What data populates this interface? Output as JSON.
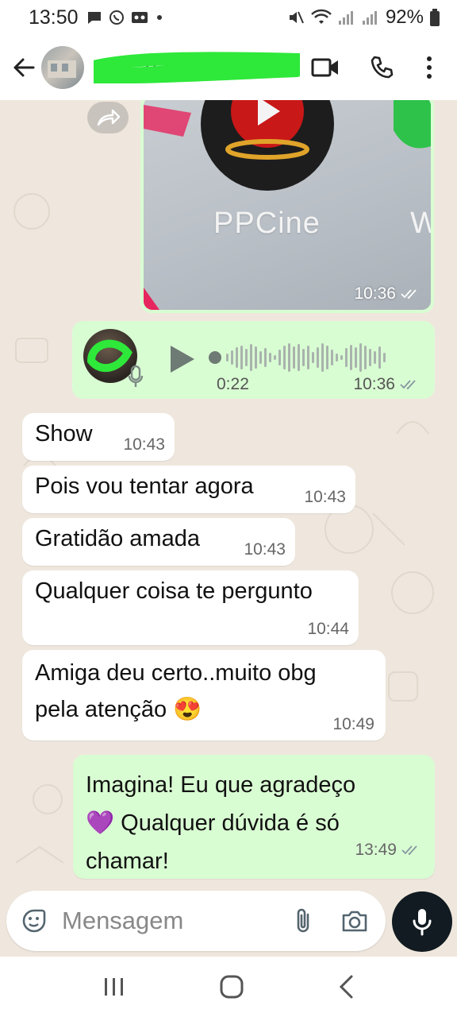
{
  "status_bar": {
    "time": "13:50",
    "battery": "92%"
  },
  "header": {
    "contact_name": "55 ... 9261 ..",
    "icons": [
      "back-arrow-icon",
      "video-call-icon",
      "phone-icon",
      "more-vert-icon"
    ]
  },
  "chat": {
    "image_message": {
      "app_label": "PPCine",
      "app_label_partial": "W",
      "time": "10:36"
    },
    "voice_message": {
      "duration": "0:22",
      "time": "10:36"
    },
    "incoming": [
      {
        "text": "Show",
        "time": "10:43"
      },
      {
        "text": "Pois vou tentar agora",
        "time": "10:43"
      },
      {
        "text": "Gratidão amada",
        "time": "10:43"
      },
      {
        "text": "Qualquer coisa te pergunto",
        "time": "10:44"
      },
      {
        "line1": "Amiga deu certo..muito obg",
        "line2": "pela atenção 😍",
        "time": "10:49"
      }
    ],
    "outgoing": {
      "line1": "Imagina! Eu que agradeço",
      "line2": "💜 Qualquer dúvida é só",
      "line3": "chamar!",
      "time": "13:49"
    }
  },
  "input": {
    "placeholder": "Mensagem"
  },
  "colors": {
    "outgoing_bubble": "#d9fdd3",
    "incoming_bubble": "#ffffff",
    "chat_bg": "#efe7dd",
    "read_ticks": "#8696a0"
  }
}
